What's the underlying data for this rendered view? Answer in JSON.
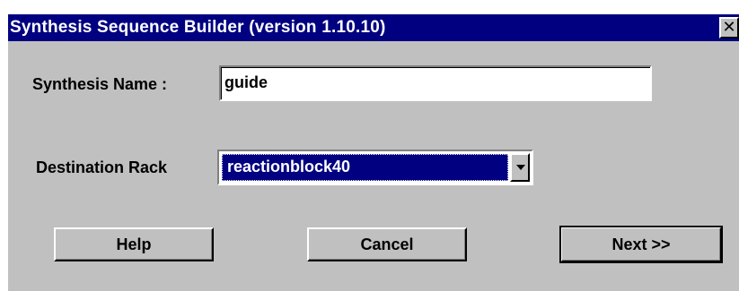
{
  "window": {
    "title": "Synthesis Sequence Builder (version 1.10.10)",
    "close_glyph": "✕",
    "close_icon": "close-icon"
  },
  "form": {
    "synthesis_name_label": "Synthesis Name :",
    "synthesis_name_value": "guide",
    "destination_rack_label": "Destination Rack",
    "destination_rack_selected": "reactionblock40",
    "dropdown_icon": "chevron-down-icon"
  },
  "buttons": {
    "help_label": "Help",
    "cancel_label": "Cancel",
    "next_label": "Next >>"
  },
  "colors": {
    "titlebar": "#000080",
    "face": "#c0c0c0",
    "selection": "#000080"
  }
}
